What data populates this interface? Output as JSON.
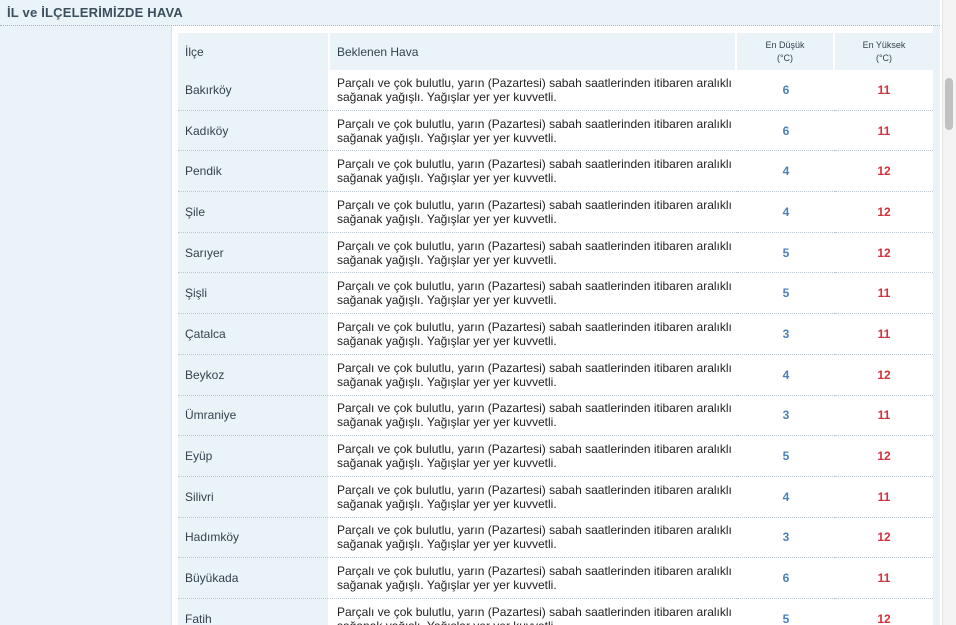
{
  "section": {
    "title": "İL ve İLÇELERİMİZDE HAVA"
  },
  "table": {
    "headers": {
      "district": "İlçe",
      "forecast": "Beklenen Hava",
      "min_line1": "En Düşük",
      "min_line2": "(°C)",
      "max_line1": "En Yüksek",
      "max_line2": "(°C)"
    },
    "rows": [
      {
        "district": "Bakırköy",
        "forecast": "Parçalı ve çok bulutlu, yarın (Pazartesi) sabah saatlerinden itibaren aralıklı sağanak yağışlı. Yağışlar yer yer kuvvetli.",
        "min": "6",
        "max": "11"
      },
      {
        "district": "Kadıköy",
        "forecast": "Parçalı ve çok bulutlu, yarın (Pazartesi) sabah saatlerinden itibaren aralıklı sağanak yağışlı. Yağışlar yer yer kuvvetli.",
        "min": "6",
        "max": "11"
      },
      {
        "district": "Pendik",
        "forecast": "Parçalı ve çok bulutlu, yarın (Pazartesi) sabah saatlerinden itibaren aralıklı sağanak yağışlı. Yağışlar yer yer kuvvetli.",
        "min": "4",
        "max": "12"
      },
      {
        "district": "Şile",
        "forecast": "Parçalı ve çok bulutlu, yarın (Pazartesi) sabah saatlerinden itibaren aralıklı sağanak yağışlı. Yağışlar yer yer kuvvetli.",
        "min": "4",
        "max": "12"
      },
      {
        "district": "Sarıyer",
        "forecast": "Parçalı ve çok bulutlu, yarın (Pazartesi) sabah saatlerinden itibaren aralıklı sağanak yağışlı. Yağışlar yer yer kuvvetli.",
        "min": "5",
        "max": "12"
      },
      {
        "district": "Şişli",
        "forecast": "Parçalı ve çok bulutlu, yarın (Pazartesi) sabah saatlerinden itibaren aralıklı sağanak yağışlı. Yağışlar yer yer kuvvetli.",
        "min": "5",
        "max": "11"
      },
      {
        "district": "Çatalca",
        "forecast": "Parçalı ve çok bulutlu, yarın (Pazartesi) sabah saatlerinden itibaren aralıklı sağanak yağışlı. Yağışlar yer yer kuvvetli.",
        "min": "3",
        "max": "11"
      },
      {
        "district": "Beykoz",
        "forecast": "Parçalı ve çok bulutlu, yarın (Pazartesi) sabah saatlerinden itibaren aralıklı sağanak yağışlı. Yağışlar yer yer kuvvetli.",
        "min": "4",
        "max": "12"
      },
      {
        "district": "Ümraniye",
        "forecast": "Parçalı ve çok bulutlu, yarın (Pazartesi) sabah saatlerinden itibaren aralıklı sağanak yağışlı. Yağışlar yer yer kuvvetli.",
        "min": "3",
        "max": "11"
      },
      {
        "district": "Eyüp",
        "forecast": "Parçalı ve çok bulutlu, yarın (Pazartesi) sabah saatlerinden itibaren aralıklı sağanak yağışlı. Yağışlar yer yer kuvvetli.",
        "min": "5",
        "max": "12"
      },
      {
        "district": "Silivri",
        "forecast": "Parçalı ve çok bulutlu, yarın (Pazartesi) sabah saatlerinden itibaren aralıklı sağanak yağışlı. Yağışlar yer yer kuvvetli.",
        "min": "4",
        "max": "11"
      },
      {
        "district": "Hadımköy",
        "forecast": "Parçalı ve çok bulutlu, yarın (Pazartesi) sabah saatlerinden itibaren aralıklı sağanak yağışlı. Yağışlar yer yer kuvvetli.",
        "min": "3",
        "max": "12"
      },
      {
        "district": "Büyükada",
        "forecast": "Parçalı ve çok bulutlu, yarın (Pazartesi) sabah saatlerinden itibaren aralıklı sağanak yağışlı. Yağışlar yer yer kuvvetli.",
        "min": "6",
        "max": "11"
      },
      {
        "district": "Fatih",
        "forecast": "Parçalı ve çok bulutlu, yarın (Pazartesi) sabah saatlerinden itibaren aralıklı sağanak yağışlı. Yağışlar yer yer kuvvetli.",
        "min": "5",
        "max": "12"
      }
    ]
  },
  "colors": {
    "min_temp": "#4a7fb8",
    "max_temp": "#d2303a",
    "panel_bg": "#eaf3f8"
  }
}
